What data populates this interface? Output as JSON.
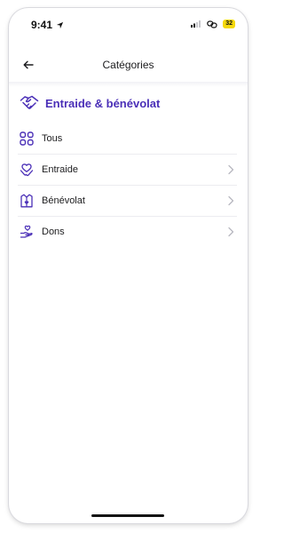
{
  "status_bar": {
    "time": "9:41",
    "battery": "32"
  },
  "nav": {
    "title": "Catégories"
  },
  "section": {
    "title": "Entraide & bénévolat"
  },
  "items": [
    {
      "label": "Tous",
      "icon": "grid-icon",
      "has_chevron": false
    },
    {
      "label": "Entraide",
      "icon": "handshake-heart-icon",
      "has_chevron": true
    },
    {
      "label": "Bénévolat",
      "icon": "volunteer-vest-icon",
      "has_chevron": true
    },
    {
      "label": "Dons",
      "icon": "donation-hand-heart-icon",
      "has_chevron": true
    }
  ],
  "colors": {
    "accent": "#4a2fb7",
    "text": "#1c1c1e",
    "battery": "#f5d90a",
    "chevron": "#b7b7bf"
  }
}
